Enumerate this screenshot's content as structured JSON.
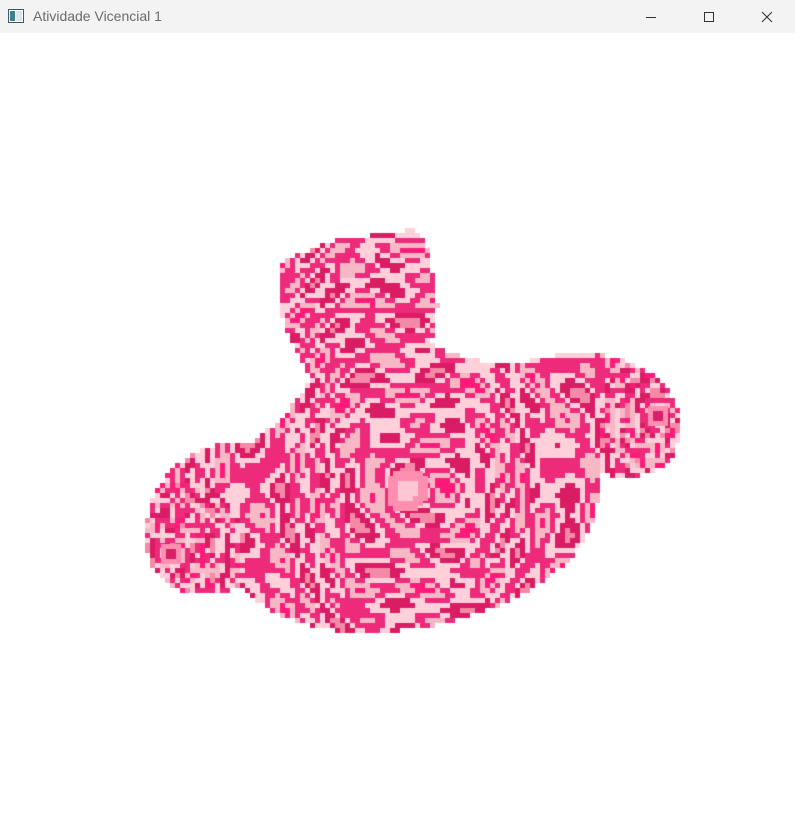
{
  "window": {
    "title": "Atividade Vicencial 1",
    "app_icon": "window-app-icon",
    "controls": {
      "minimize_icon": "minimize-icon",
      "maximize_icon": "maximize-icon",
      "close_icon": "close-icon"
    }
  },
  "viewport": {
    "background_color": "#ffffff",
    "model": "suzanne-monkey-head",
    "texture_colors": [
      "#ff1a7a",
      "#f7b7c5",
      "#ee2a7b",
      "#ffd0da",
      "#d91c63",
      "#f58aa8"
    ]
  }
}
